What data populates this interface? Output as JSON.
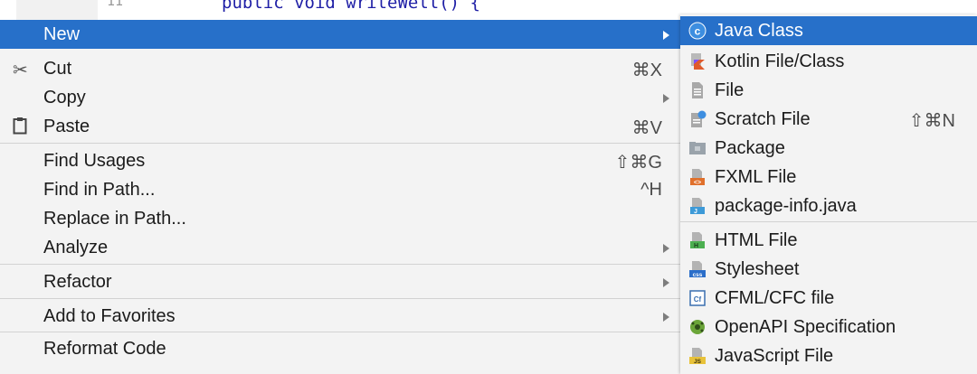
{
  "editor": {
    "line_number": "11",
    "code": "public void writeWell() {"
  },
  "menu": {
    "items": [
      {
        "label": "New",
        "shortcut": "",
        "submenu": true
      },
      {
        "label": "Cut",
        "shortcut": "⌘X",
        "icon": "scissors-icon"
      },
      {
        "label": "Copy",
        "shortcut": "",
        "submenu": true
      },
      {
        "label": "Paste",
        "shortcut": "⌘V",
        "icon": "clipboard-icon"
      },
      {
        "label": "Find Usages",
        "shortcut": "⇧⌘G"
      },
      {
        "label": "Find in Path...",
        "shortcut": "^H"
      },
      {
        "label": "Replace in Path...",
        "shortcut": ""
      },
      {
        "label": "Analyze",
        "shortcut": "",
        "submenu": true
      },
      {
        "label": "Refactor",
        "shortcut": "",
        "submenu": true
      },
      {
        "label": "Add to Favorites",
        "shortcut": "",
        "submenu": true
      },
      {
        "label": "Reformat Code",
        "shortcut": ""
      }
    ]
  },
  "submenu": {
    "items": [
      {
        "label": "Java Class",
        "icon": "java-class-icon"
      },
      {
        "label": "Kotlin File/Class",
        "icon": "kotlin-icon"
      },
      {
        "label": "File",
        "icon": "file-icon"
      },
      {
        "label": "Scratch File",
        "shortcut": "⇧⌘N",
        "icon": "scratch-file-icon"
      },
      {
        "label": "Package",
        "icon": "package-folder-icon"
      },
      {
        "label": "FXML File",
        "icon": "fxml-file-icon"
      },
      {
        "label": "package-info.java",
        "icon": "java-file-icon"
      },
      {
        "label": "HTML File",
        "icon": "html-file-icon"
      },
      {
        "label": "Stylesheet",
        "icon": "css-file-icon"
      },
      {
        "label": "CFML/CFC file",
        "icon": "cfml-file-icon"
      },
      {
        "label": "OpenAPI Specification",
        "icon": "openapi-icon"
      },
      {
        "label": "JavaScript File",
        "icon": "javascript-file-icon"
      }
    ]
  },
  "colors": {
    "selection": "#2770c9",
    "menu_bg": "#f3f3f3",
    "separator": "#d2d2d2"
  }
}
